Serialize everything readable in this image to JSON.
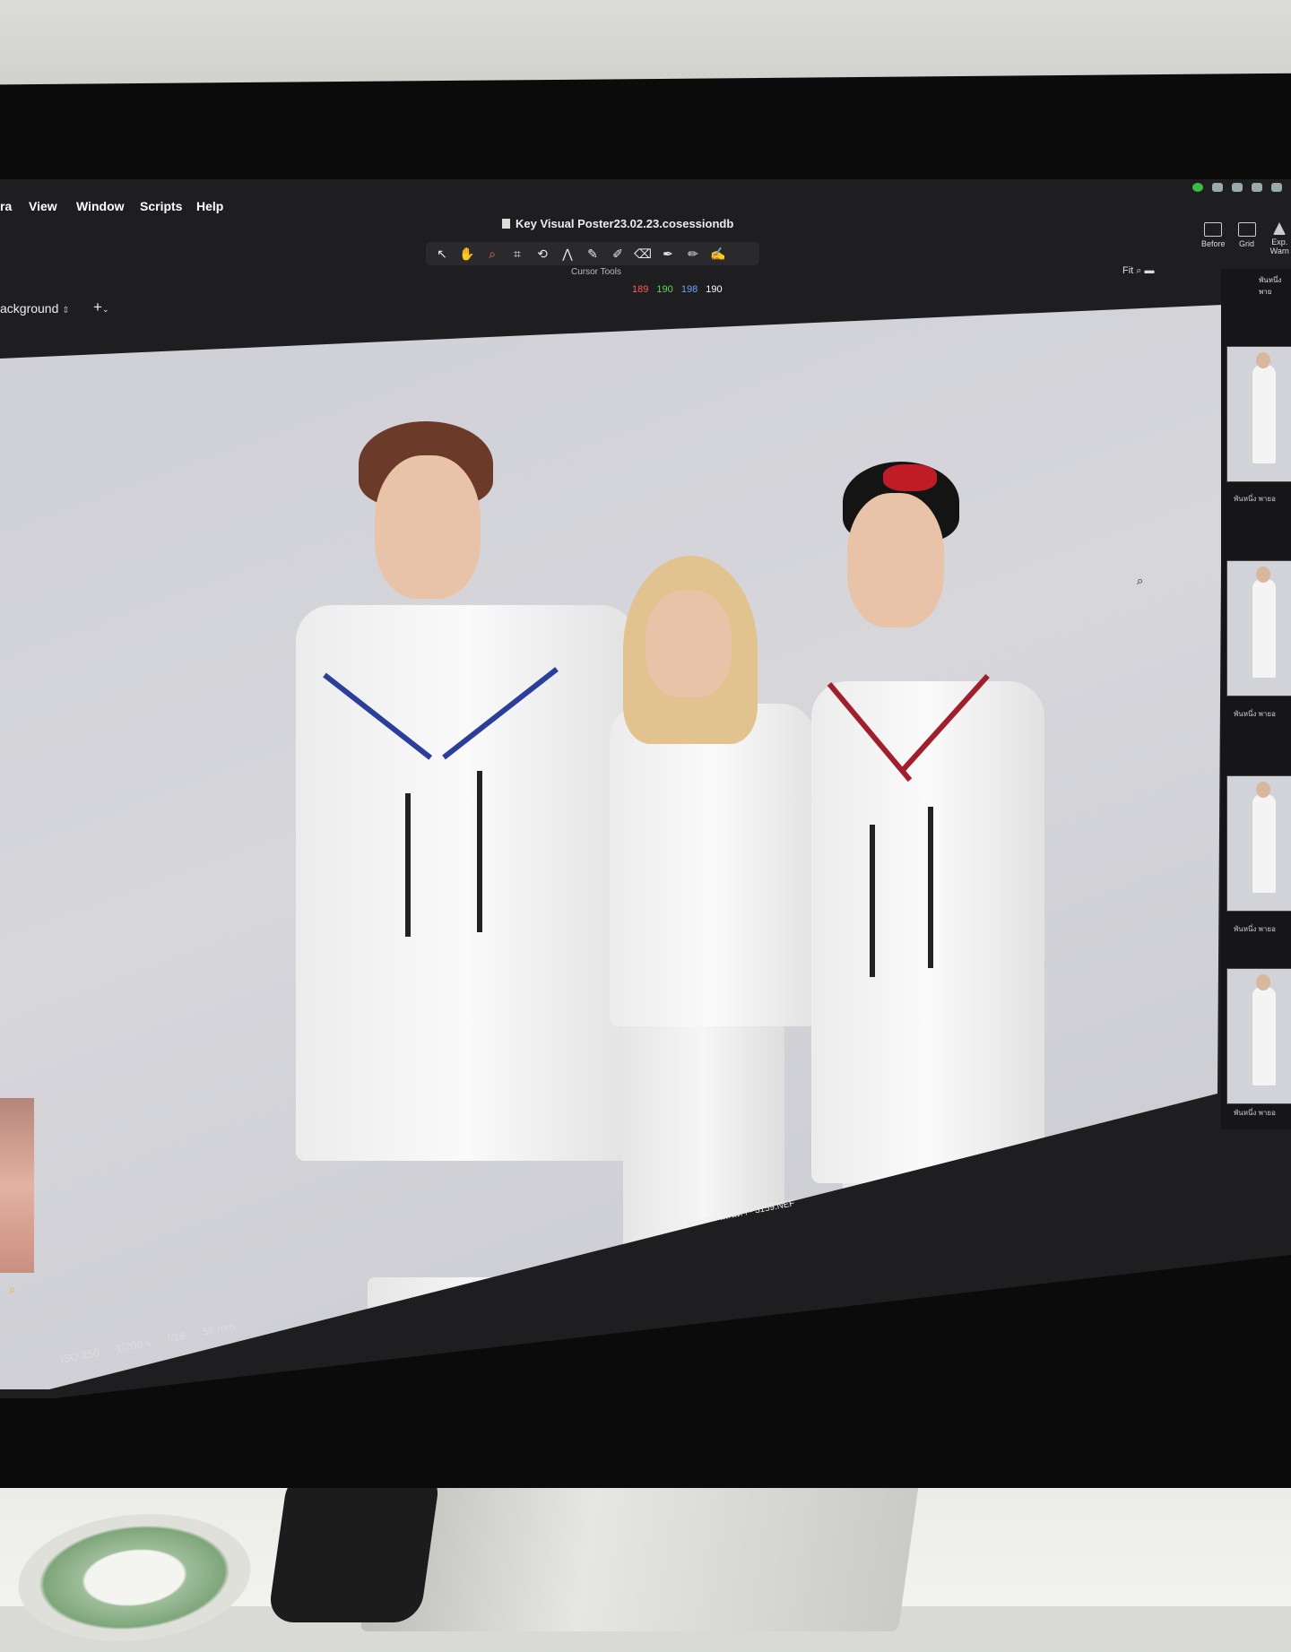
{
  "menubar": {
    "items": [
      "ra",
      "View",
      "Window",
      "Scripts",
      "Help"
    ]
  },
  "window": {
    "title": "Key Visual Poster23.02.23.cosessiondb"
  },
  "toolbar": {
    "tools": [
      {
        "icon": "arrow-pointer-icon",
        "glyph": "↖"
      },
      {
        "icon": "hand-pan-icon",
        "glyph": "✋"
      },
      {
        "icon": "zoom-icon",
        "glyph": "⌕"
      },
      {
        "icon": "crop-icon",
        "glyph": "⌗"
      },
      {
        "icon": "rotate-icon",
        "glyph": "⟲"
      },
      {
        "icon": "keystone-icon",
        "glyph": "⋀"
      },
      {
        "icon": "picker-icon",
        "glyph": "✎"
      },
      {
        "icon": "brush-icon",
        "glyph": "✐"
      },
      {
        "icon": "eraser-icon",
        "glyph": "⌫"
      },
      {
        "icon": "pen-icon",
        "glyph": "✒"
      },
      {
        "icon": "pencil-icon",
        "glyph": "✏"
      },
      {
        "icon": "annotate-icon",
        "glyph": "✍"
      }
    ],
    "caption": "Cursor Tools"
  },
  "readout": {
    "r": "189",
    "g": "190",
    "b": "198",
    "l": "190",
    "colors": {
      "r": "#ff5a5a",
      "g": "#5dd65d",
      "b": "#6aa0ff",
      "l": "#ffffff"
    }
  },
  "right_tools": {
    "labels": [
      "Before",
      "Grid",
      "Exp. Warn"
    ]
  },
  "view": {
    "fit_label": "Fit"
  },
  "layer": {
    "label": "ackground",
    "add": "+"
  },
  "photo": {
    "filename": "พันหนึ่ง พายอาร์ แสนต่ำ - 3159.NEF",
    "meta": [
      "ISO 250",
      "1/200 s",
      "f/16",
      "58 mm"
    ]
  },
  "strip": {
    "header": "พันหนึ่ง พาย",
    "thumb_labels": [
      "พันหนึ่ง พายอ",
      "พันหนึ่ง พายอ",
      "พันหนึ่ง พายอ",
      "พันหนึ่ง พายอ"
    ]
  }
}
